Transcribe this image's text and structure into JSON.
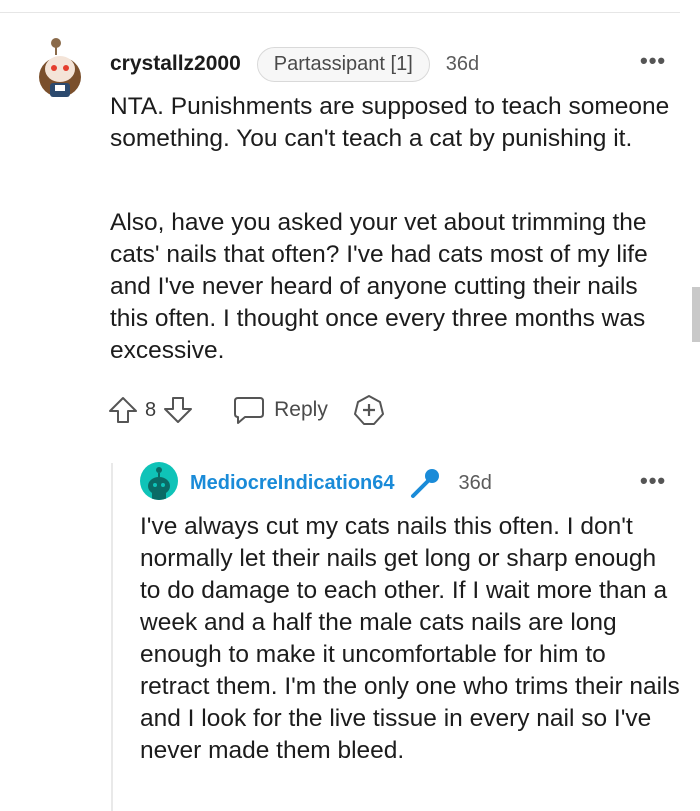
{
  "comments": [
    {
      "username": "crystallz2000",
      "flair": "Partassipant [1]",
      "time": "36d",
      "more": "•••",
      "paragraphs": [
        "NTA. Punishments are supposed to teach someone something. You can't teach a cat by punishing it.",
        "Also, have you asked your vet about trimming the cats' nails that often? I've had cats most of my life and I've never heard of anyone cutting their nails this often. I thought once every three months was excessive."
      ],
      "votes": "8",
      "reply_label": "Reply"
    },
    {
      "username": "MediocreIndication64",
      "time": "36d",
      "more": "•••",
      "paragraphs": [
        "I've always cut my cats nails this often. I don't normally let their nails get long or sharp enough to do damage to each other. If I wait more than a week and a half the male cats nails are long enough to make it uncomfortable for him to retract them. I'm the only one who trims their nails and I look for the live tissue in every nail so I've never made them bleed."
      ]
    }
  ],
  "colors": {
    "username_link": "#1a8bd8",
    "avatar2_bg": "#0fc3b8",
    "mic_icon": "#1a8bd8"
  },
  "icons": [
    "avatar",
    "mic-icon",
    "upvote-icon",
    "downvote-icon",
    "reply-icon",
    "award-icon",
    "more-options-icon"
  ]
}
